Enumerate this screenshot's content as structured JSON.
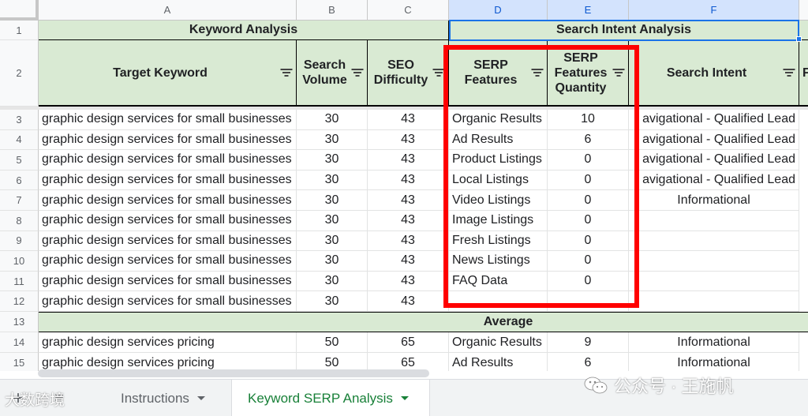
{
  "columns": [
    "A",
    "B",
    "C",
    "D",
    "E",
    "F"
  ],
  "rows": [
    "1",
    "2",
    "3",
    "4",
    "5",
    "6",
    "7",
    "8",
    "9",
    "10",
    "11",
    "12",
    "13",
    "14",
    "15"
  ],
  "groups": {
    "keyword_analysis": "Keyword Analysis",
    "search_intent_analysis": "Search Intent Analysis"
  },
  "headers": {
    "target_keyword": "Target Keyword",
    "search_volume": "Search Volume",
    "seo_difficulty": "SEO Difficulty",
    "serp_features": "SERP Features",
    "serp_features_quantity": "SERP Features Quantity",
    "search_intent": "Search Intent",
    "partial_next": "F"
  },
  "data_rows": [
    {
      "keyword": "graphic design services for small businesses",
      "volume": "30",
      "difficulty": "43",
      "serp_feature": "Organic Results",
      "quantity": "10",
      "intent": "avigational - Qualified Lead"
    },
    {
      "keyword": "graphic design services for small businesses",
      "volume": "30",
      "difficulty": "43",
      "serp_feature": "Ad Results",
      "quantity": "6",
      "intent": "avigational - Qualified Lead"
    },
    {
      "keyword": "graphic design services for small businesses",
      "volume": "30",
      "difficulty": "43",
      "serp_feature": "Product Listings",
      "quantity": "0",
      "intent": "avigational - Qualified Lead"
    },
    {
      "keyword": "graphic design services for small businesses",
      "volume": "30",
      "difficulty": "43",
      "serp_feature": "Local Listings",
      "quantity": "0",
      "intent": "avigational - Qualified Lead"
    },
    {
      "keyword": "graphic design services for small businesses",
      "volume": "30",
      "difficulty": "43",
      "serp_feature": "Video Listings",
      "quantity": "0",
      "intent": "Informational"
    },
    {
      "keyword": "graphic design services for small businesses",
      "volume": "30",
      "difficulty": "43",
      "serp_feature": "Image Listings",
      "quantity": "0",
      "intent": ""
    },
    {
      "keyword": "graphic design services for small businesses",
      "volume": "30",
      "difficulty": "43",
      "serp_feature": "Fresh Listings",
      "quantity": "0",
      "intent": ""
    },
    {
      "keyword": "graphic design services for small businesses",
      "volume": "30",
      "difficulty": "43",
      "serp_feature": "News Listings",
      "quantity": "0",
      "intent": ""
    },
    {
      "keyword": "graphic design services for small businesses",
      "volume": "30",
      "difficulty": "43",
      "serp_feature": "FAQ Data",
      "quantity": "0",
      "intent": ""
    },
    {
      "keyword": "graphic design services for small businesses",
      "volume": "30",
      "difficulty": "43",
      "serp_feature": "",
      "quantity": "",
      "intent": ""
    }
  ],
  "average_label": "Average",
  "data_rows_after": [
    {
      "keyword": "graphic design services pricing",
      "volume": "50",
      "difficulty": "65",
      "serp_feature": "Organic Results",
      "quantity": "9",
      "intent": "Informational"
    },
    {
      "keyword": "graphic design services pricing",
      "volume": "50",
      "difficulty": "65",
      "serp_feature": "Ad Results",
      "quantity": "6",
      "intent": "Informational"
    }
  ],
  "tabs": {
    "instructions": "Instructions",
    "keyword_serp": "Keyword SERP Analysis"
  },
  "toolbar": {
    "add_sheet": "+",
    "all_sheets": "≡"
  },
  "watermarks": {
    "left": "大数跨境",
    "right": "公众号 · 王施帆"
  },
  "colors": {
    "header_green": "#d9ead3",
    "highlight_red": "#ff0000",
    "selection_blue": "#1a73e8",
    "active_tab_green": "#188038"
  }
}
